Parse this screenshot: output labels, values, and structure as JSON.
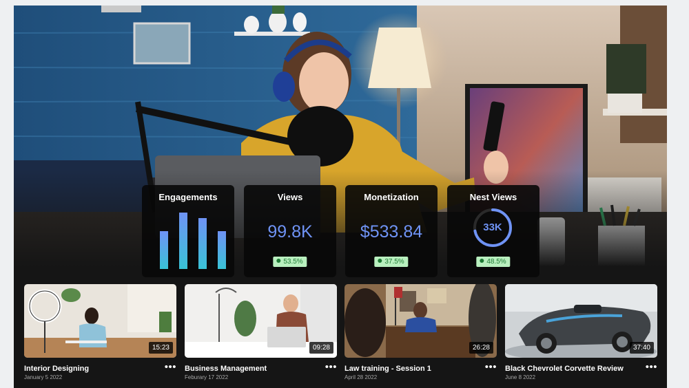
{
  "stats": [
    {
      "title": "Engagements"
    },
    {
      "title": "Views",
      "value": "99.8K",
      "change": "53.5%"
    },
    {
      "title": "Monetization",
      "value": "$533.84",
      "change": "37.5%"
    },
    {
      "title": "Nest Views",
      "value": "33K",
      "ring_fraction": 0.72,
      "change": "48.5%"
    }
  ],
  "engagement_bars": [
    0.55,
    0.82,
    0.74,
    0.55
  ],
  "videos": [
    {
      "title": "Interior Designing",
      "date": "January 5 2022",
      "duration": "15:23"
    },
    {
      "title": "Business Management",
      "date": "Feburary 17 2022",
      "duration": "09:28"
    },
    {
      "title": "Law training - Session 1",
      "date": "April 28 2022",
      "duration": "26:28"
    },
    {
      "title": "Black Chevrolet Corvette Review",
      "date": "June 8 2022",
      "duration": "37:40"
    }
  ],
  "more_glyph": "•••",
  "colors": {
    "accent": "#6f93f5",
    "badge_bg": "#b9f0bf",
    "badge_text": "#1d7a34",
    "bg": "#151515"
  }
}
